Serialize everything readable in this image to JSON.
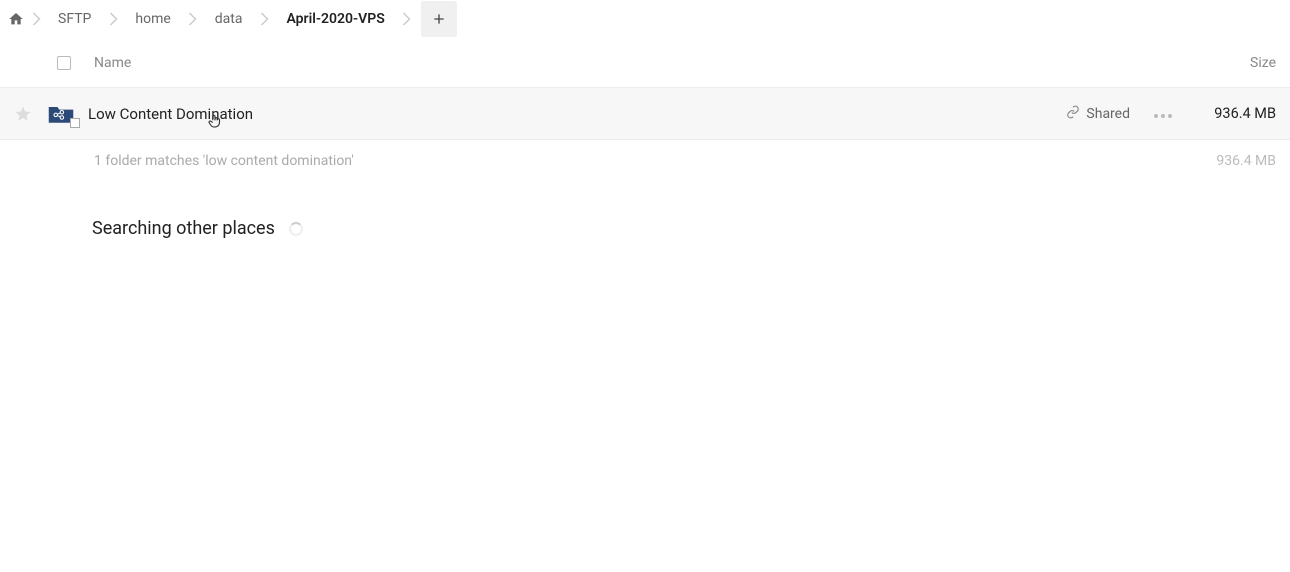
{
  "breadcrumb": {
    "items": [
      {
        "label": "SFTP"
      },
      {
        "label": "home"
      },
      {
        "label": "data"
      },
      {
        "label": "April-2020-VPS",
        "current": true
      }
    ]
  },
  "header": {
    "name": "Name",
    "size": "Size"
  },
  "row": {
    "name": "Low Content Domination",
    "shared": "Shared",
    "size": "936.4 MB"
  },
  "summary": {
    "text": "1 folder matches 'low content domination'",
    "size": "936.4 MB"
  },
  "searching": {
    "label": "Searching other places"
  }
}
